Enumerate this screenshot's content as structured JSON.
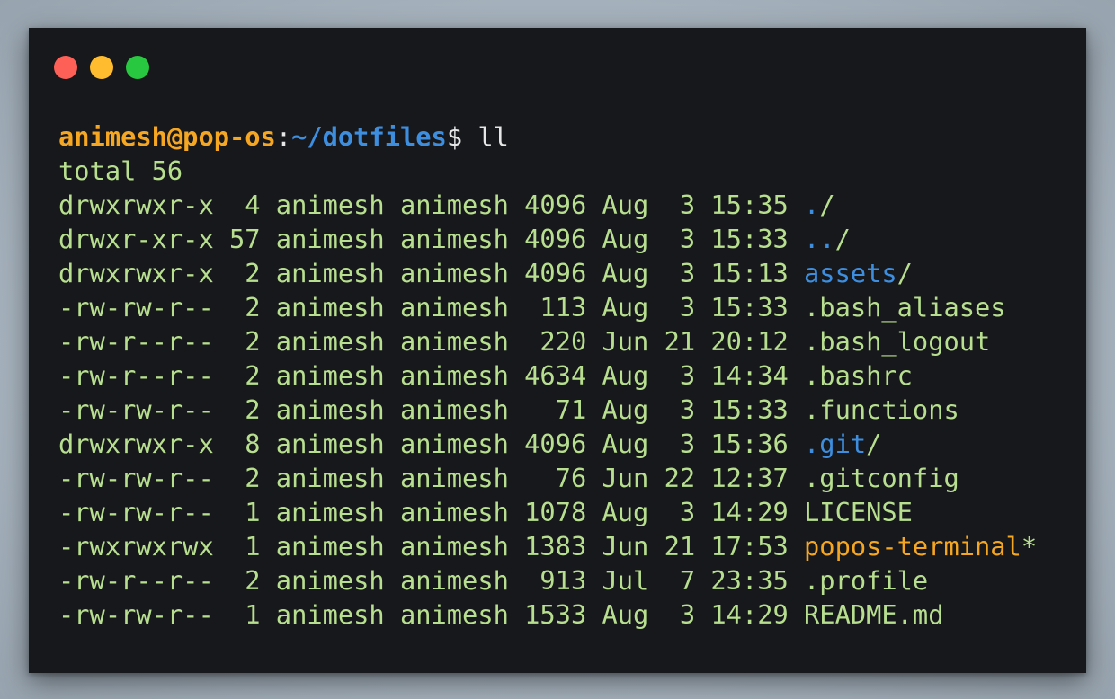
{
  "window": {
    "buttons": [
      {
        "name": "close",
        "color": "#fe5f57"
      },
      {
        "name": "minimize",
        "color": "#febc2e"
      },
      {
        "name": "maximize",
        "color": "#28c840"
      }
    ]
  },
  "prompt": {
    "user_host": "animesh@pop-os",
    "colon": ":",
    "path": "~/dotfiles",
    "dollar": "$",
    "command": " ll"
  },
  "total_line": "total 56",
  "entries": [
    {
      "meta": "drwxrwxr-x  4 animesh animesh 4096 Aug  3 15:35 ",
      "name": ".",
      "suffix": "/",
      "kind": "dir"
    },
    {
      "meta": "drwxr-xr-x 57 animesh animesh 4096 Aug  3 15:33 ",
      "name": "..",
      "suffix": "/",
      "kind": "dir"
    },
    {
      "meta": "drwxrwxr-x  2 animesh animesh 4096 Aug  3 15:13 ",
      "name": "assets",
      "suffix": "/",
      "kind": "dir"
    },
    {
      "meta": "-rw-rw-r--  2 animesh animesh  113 Aug  3 15:33 ",
      "name": ".bash_aliases",
      "suffix": "",
      "kind": "file"
    },
    {
      "meta": "-rw-r--r--  2 animesh animesh  220 Jun 21 20:12 ",
      "name": ".bash_logout",
      "suffix": "",
      "kind": "file"
    },
    {
      "meta": "-rw-r--r--  2 animesh animesh 4634 Aug  3 14:34 ",
      "name": ".bashrc",
      "suffix": "",
      "kind": "file"
    },
    {
      "meta": "-rw-rw-r--  2 animesh animesh   71 Aug  3 15:33 ",
      "name": ".functions",
      "suffix": "",
      "kind": "file"
    },
    {
      "meta": "drwxrwxr-x  8 animesh animesh 4096 Aug  3 15:36 ",
      "name": ".git",
      "suffix": "/",
      "kind": "dir"
    },
    {
      "meta": "-rw-rw-r--  2 animesh animesh   76 Jun 22 12:37 ",
      "name": ".gitconfig",
      "suffix": "",
      "kind": "file"
    },
    {
      "meta": "-rw-rw-r--  1 animesh animesh 1078 Aug  3 14:29 ",
      "name": "LICENSE",
      "suffix": "",
      "kind": "file"
    },
    {
      "meta": "-rwxrwxrwx  1 animesh animesh 1383 Jun 21 17:53 ",
      "name": "popos-terminal",
      "suffix": "*",
      "kind": "exec"
    },
    {
      "meta": "-rw-r--r--  2 animesh animesh  913 Jul  7 23:35 ",
      "name": ".profile",
      "suffix": "",
      "kind": "file"
    },
    {
      "meta": "-rw-rw-r--  1 animesh animesh 1533 Aug  3 14:29 ",
      "name": "README.md",
      "suffix": "",
      "kind": "file"
    }
  ]
}
